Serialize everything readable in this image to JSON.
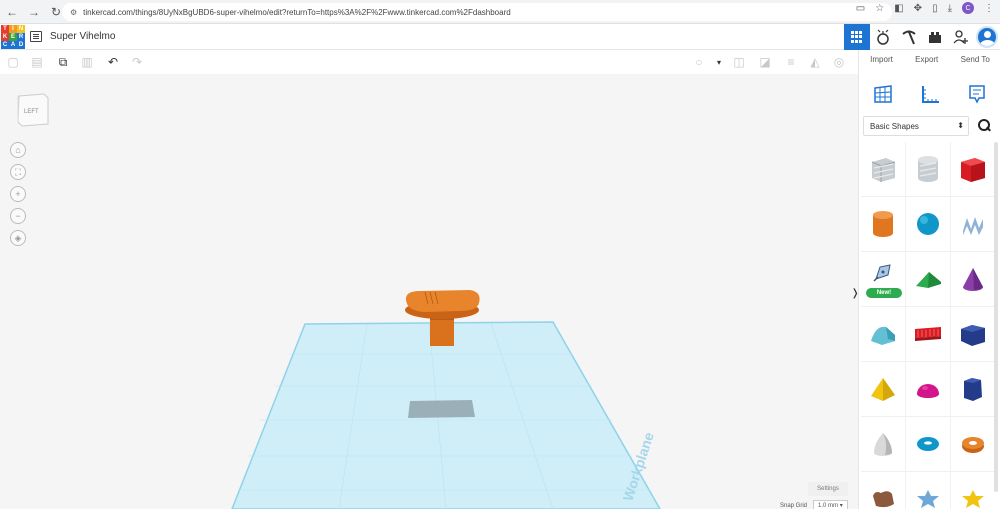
{
  "browser": {
    "url": "tinkercad.com/things/8UyNxBgUBD6-super-vihelmo/edit?returnTo=https%3A%2F%2Fwww.tinkercad.com%2Fdashboard",
    "profile_initial": "C"
  },
  "header": {
    "logo_letters": [
      "T",
      "I",
      "N",
      "K",
      "E",
      "R",
      "C",
      "A",
      "D"
    ],
    "project_title": "Super Vihelmo"
  },
  "panel": {
    "import_label": "Import",
    "export_label": "Export",
    "send_to_label": "Send To",
    "shape_category": "Basic Shapes",
    "new_badge": "New!"
  },
  "viewport": {
    "viewcube_label": "LEFT",
    "workplane_label": "Workplane",
    "settings_label": "Settings",
    "snap_grid_label": "Snap Grid",
    "snap_grid_value": "1.0 mm"
  },
  "colors": {
    "accent": "#1e74d3",
    "workplane": "#cfeef7",
    "object_orange": "#e0761f",
    "new_badge": "#2eab4f"
  }
}
